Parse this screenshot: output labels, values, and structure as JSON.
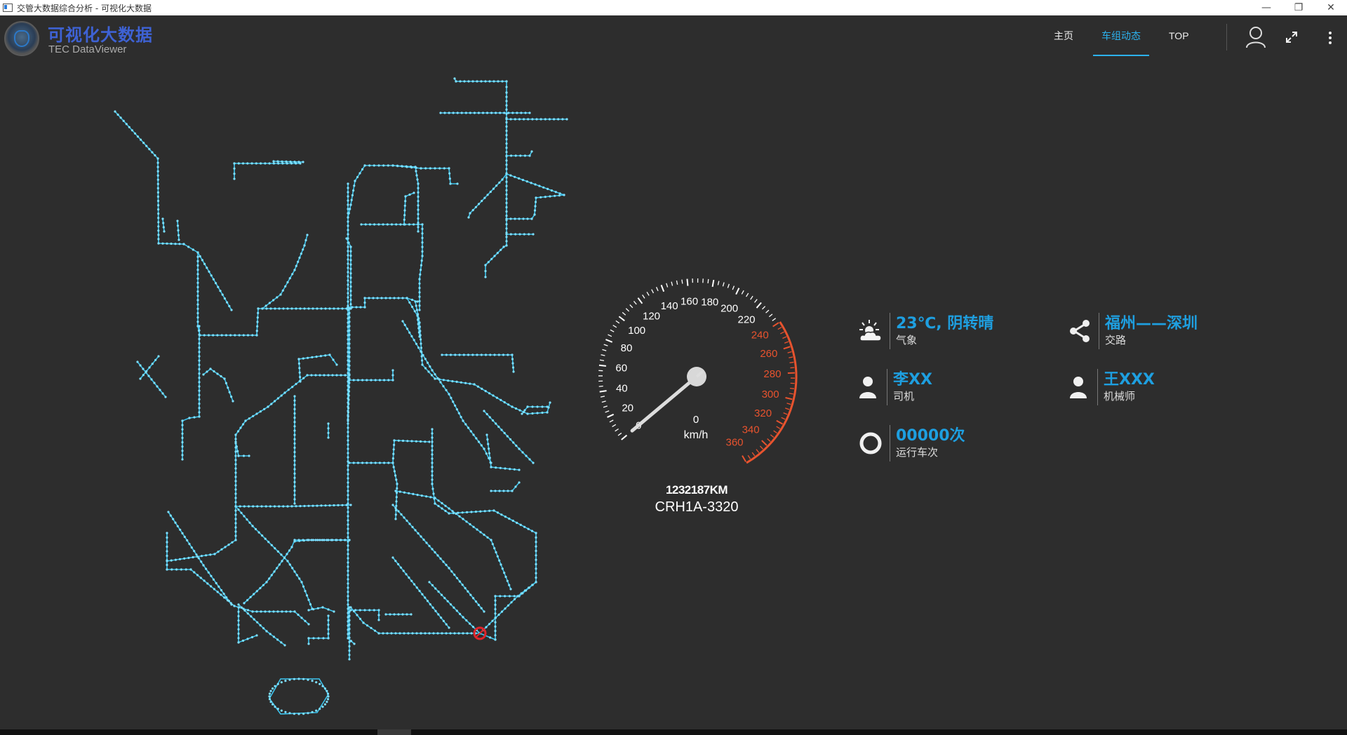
{
  "window": {
    "title": "交管大数据综合分析 - 可视化大数据",
    "controls": {
      "minimize": "—",
      "restore": "❐",
      "close": "✕"
    }
  },
  "header": {
    "brand_title": "可视化大数据",
    "brand_subtitle": "TEC DataViewer",
    "nav": [
      {
        "label": "主页",
        "active": false
      },
      {
        "label": "车组动态",
        "active": true
      },
      {
        "label": "TOP",
        "active": false
      }
    ],
    "icons": [
      "user-icon",
      "expand-icon",
      "more-vertical-icon"
    ]
  },
  "map": {
    "marker_color": "#e0242a",
    "line_color": "#3cc4ee"
  },
  "gauge": {
    "speed": 0,
    "unit": "km/h",
    "max": 360,
    "tick_labels": [
      0,
      20,
      40,
      60,
      80,
      100,
      120,
      140,
      160,
      180,
      200,
      220,
      240,
      260,
      280,
      300,
      320,
      340,
      360
    ],
    "redline_from": 240,
    "normal_color": "#ffffff",
    "red_color": "#e8532e"
  },
  "odometer": "1232187KM",
  "train_id": "CRH1A-3320",
  "info": {
    "weather": {
      "value": "23℃, 阴转晴",
      "label": "气象",
      "icon": "weather-icon"
    },
    "route": {
      "value": "福州——深圳",
      "label": "交路",
      "icon": "share-icon"
    },
    "driver": {
      "value": "李XX",
      "label": "司机",
      "icon": "person-icon"
    },
    "mechanic": {
      "value": "王XXX",
      "label": "机械师",
      "icon": "person-icon"
    },
    "runs": {
      "value": "00000次",
      "label": "运行车次",
      "icon": "ring-icon"
    }
  }
}
